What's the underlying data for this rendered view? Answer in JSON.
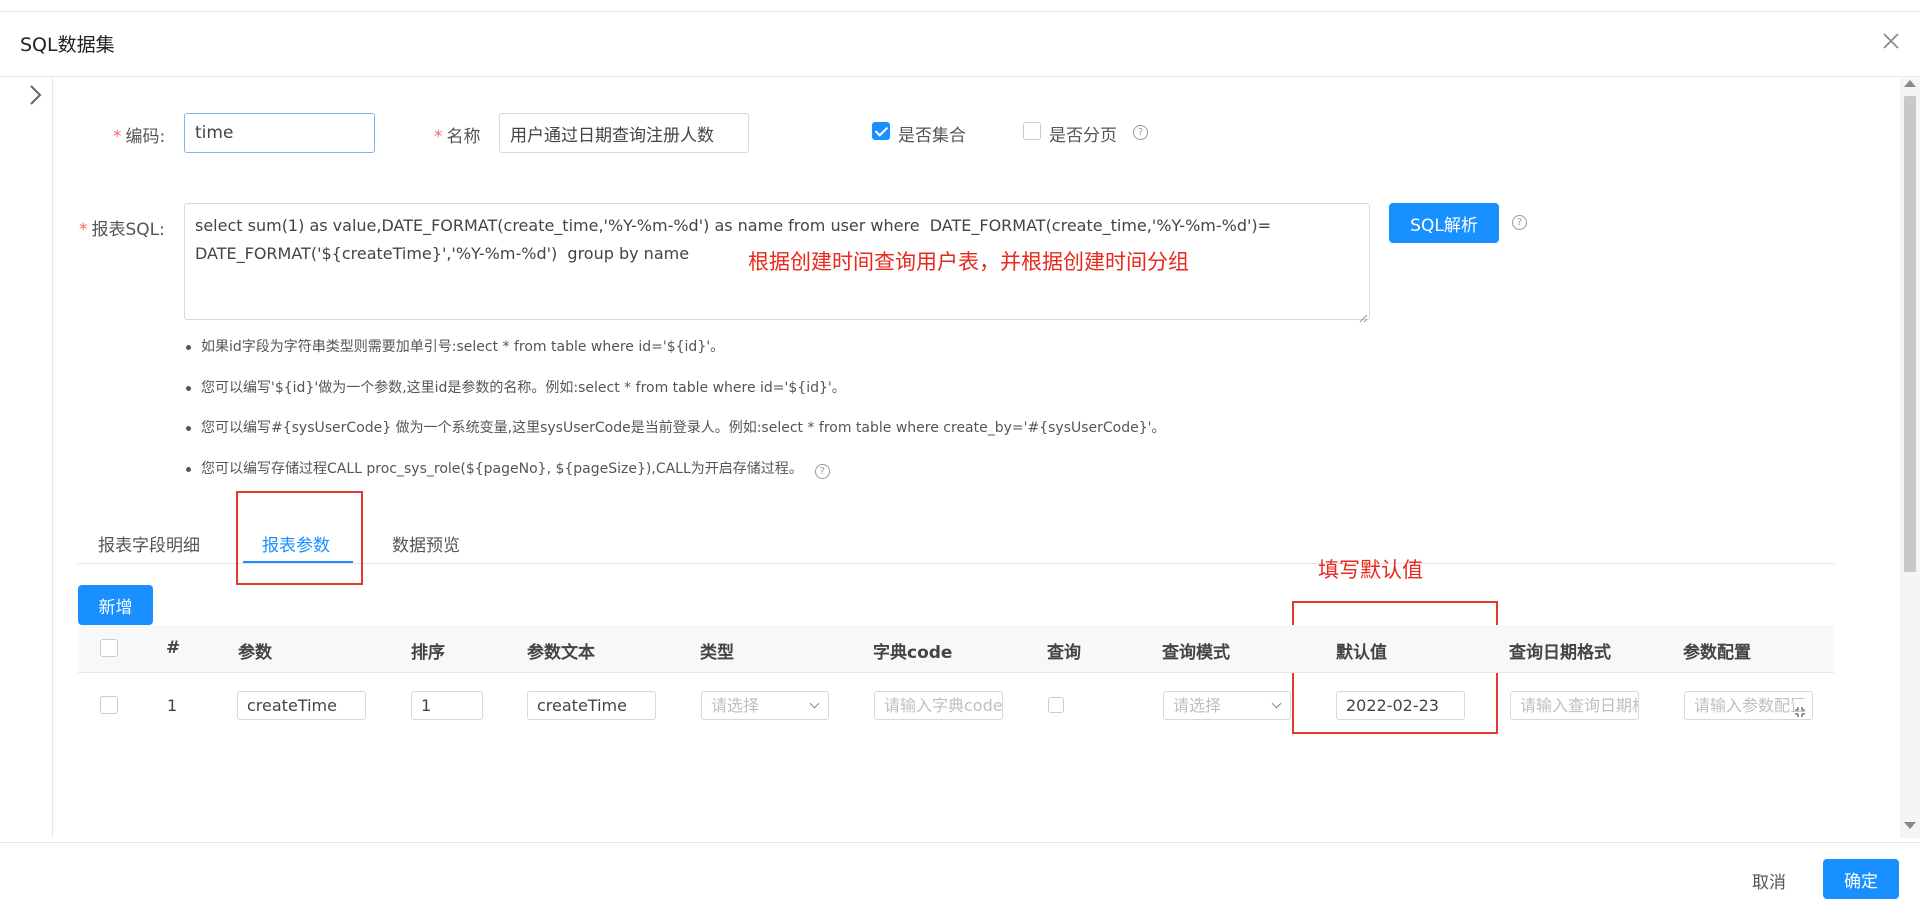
{
  "modal": {
    "title": "SQL数据集",
    "close_icon": "close-icon"
  },
  "form": {
    "code_label": "编码:",
    "code_value": "time",
    "name_label": "名称",
    "name_value": "用户通过日期查询注册人数",
    "is_collection_label": "是否集合",
    "is_collection_checked": true,
    "is_paged_label": "是否分页",
    "is_paged_checked": false,
    "sql_label": "报表SQL:",
    "sql_value": "select sum(1) as value,DATE_FORMAT(create_time,'%Y-%m-%d') as name from user where  DATE_FORMAT(create_time,'%Y-%m-%d')=\nDATE_FORMAT('${createTime}','%Y-%m-%d')  group by name",
    "sql_parse_button": "SQL解析",
    "required_mark": "*"
  },
  "annotations": {
    "sql_note": "根据创建时间查询用户表，并根据创建时间分组",
    "default_note": "填写默认值",
    "color": "#e8291c"
  },
  "tips": [
    "如果id字段为字符串类型则需要加单引号:select * from table where id='${id}'。",
    "您可以编写'${id}'做为一个参数,这里id是参数的名称。例如:select * from table where id='${id}'。",
    "您可以编写#{sysUserCode} 做为一个系统变量,这里sysUserCode是当前登录人。例如:select * from table where create_by='#{sysUserCode}'。",
    "您可以编写存储过程CALL proc_sys_role(${pageNo}, ${pageSize}),CALL为开启存储过程。"
  ],
  "tabs": [
    {
      "label": "报表字段明细",
      "active": false
    },
    {
      "label": "报表参数",
      "active": true
    },
    {
      "label": "数据预览",
      "active": false
    }
  ],
  "table": {
    "add_button": "新增",
    "headers": [
      "#",
      "参数",
      "排序",
      "参数文本",
      "类型",
      "字典code",
      "查询",
      "查询模式",
      "默认值",
      "查询日期格式",
      "参数配置"
    ],
    "rows": [
      {
        "index": "1",
        "param": "createTime",
        "order": "1",
        "param_text": "createTime",
        "type_placeholder": "请选择",
        "dict_placeholder": "请输入字典code",
        "query_checked": false,
        "mode_placeholder": "请选择",
        "default_value": "2022-02-23",
        "date_format_placeholder": "请输入查询日期格式",
        "config_placeholder": "请输入参数配置"
      }
    ]
  },
  "footer": {
    "cancel": "取消",
    "confirm": "确定"
  },
  "colors": {
    "primary": "#1890ff",
    "highlight_box": "#e23a2e"
  }
}
